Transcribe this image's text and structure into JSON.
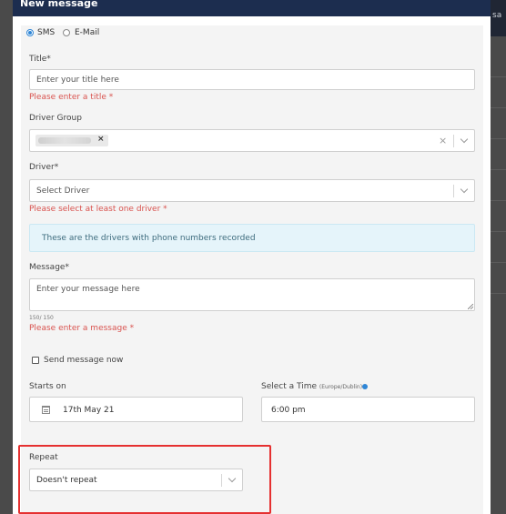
{
  "modal": {
    "title": "New message",
    "collapse_icon": "chevron-up-icon"
  },
  "background": {
    "edge_text": "sa"
  },
  "form": {
    "channel": {
      "options": [
        "SMS",
        "E-Mail"
      ],
      "selected": "SMS"
    },
    "title": {
      "label": "Title*",
      "placeholder": "Enter your title here",
      "error": "Please enter a title *"
    },
    "driver_group": {
      "label": "Driver Group",
      "tag_remove": "×",
      "clear": "×"
    },
    "driver": {
      "label": "Driver*",
      "placeholder": "Select Driver",
      "error": "Please select at least one driver *"
    },
    "info": {
      "text": "These are the drivers with phone numbers recorded"
    },
    "message": {
      "label": "Message*",
      "placeholder": "Enter your message here",
      "counter": "150/ 150",
      "error": "Please enter a message *"
    },
    "send_now": {
      "label": "Send message now",
      "checked": false
    },
    "starts_on": {
      "label": "Starts on",
      "value": "17th May 21"
    },
    "time": {
      "label": "Select a Time",
      "timezone": "(Europe/Dublin)",
      "value": "6:00 pm"
    },
    "repeat": {
      "label": "Repeat",
      "value": "Doesn't repeat"
    }
  },
  "colors": {
    "header": "#1c2d4f",
    "error": "#d9534f",
    "accent": "#2f86d6",
    "highlight": "#e53030"
  }
}
